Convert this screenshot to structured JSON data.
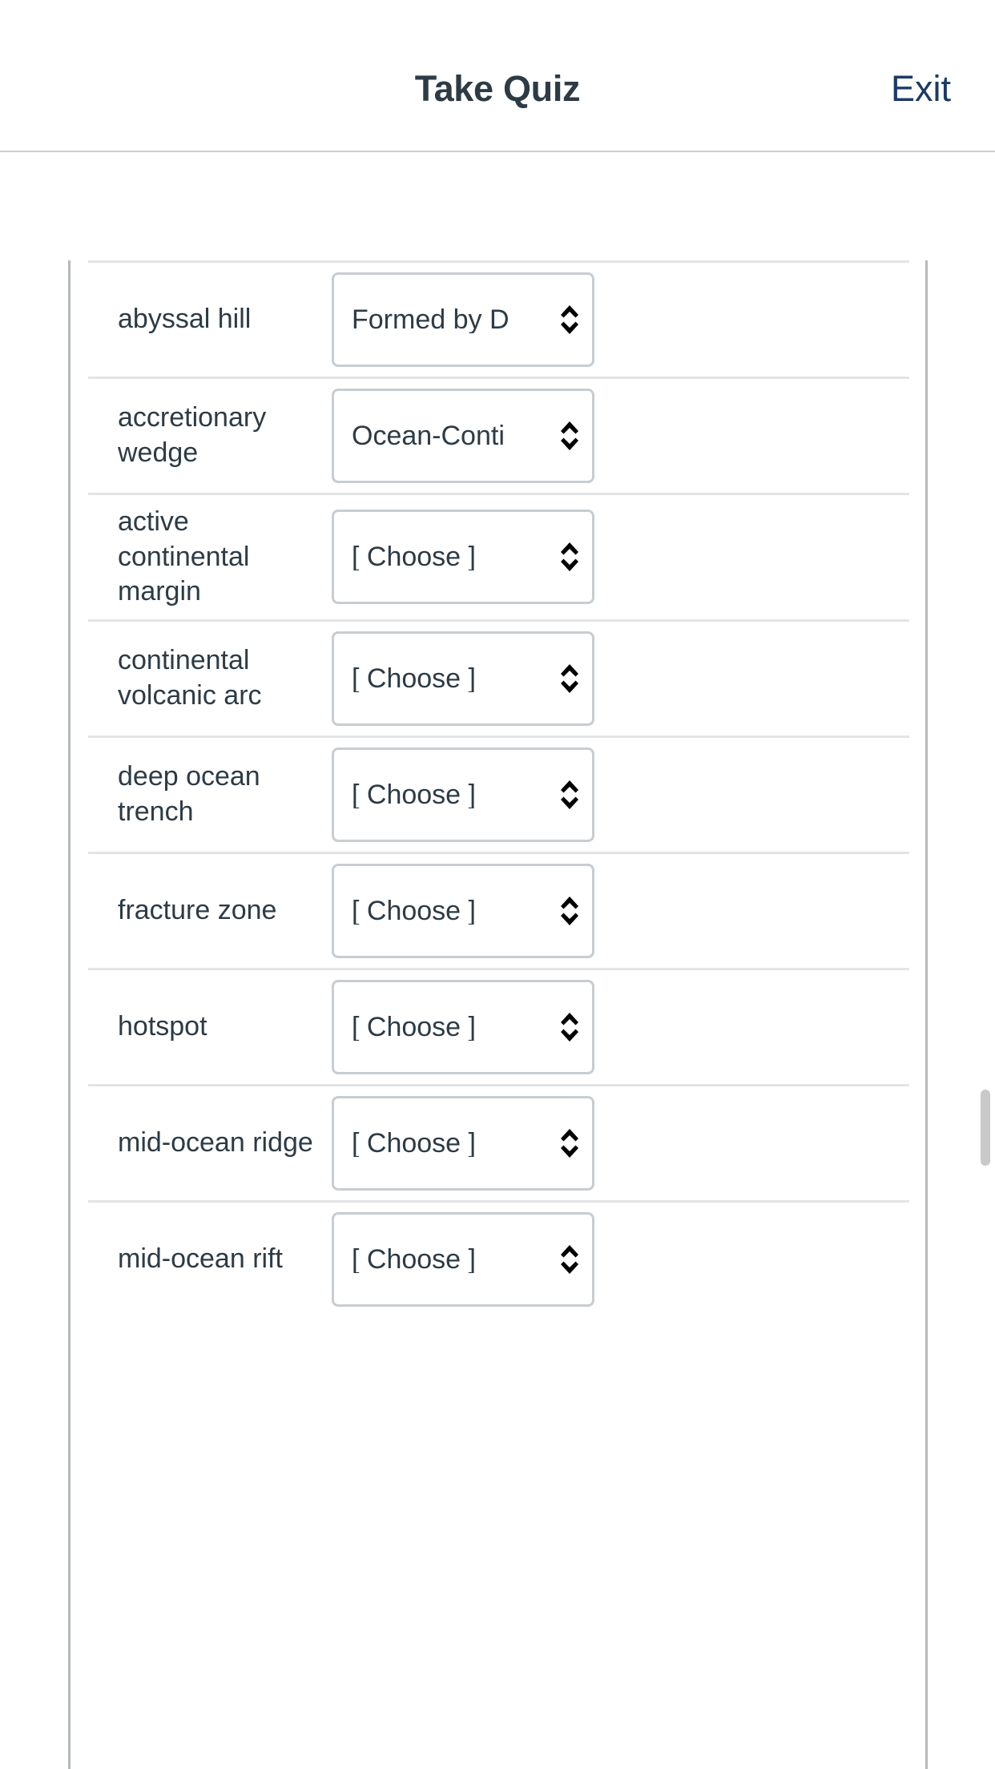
{
  "header": {
    "title": "Take Quiz",
    "exit_label": "Exit"
  },
  "quiz": {
    "rows": [
      {
        "term": "abyssal hill",
        "selected": "Formed by D",
        "icon": "chevron-up-down-icon"
      },
      {
        "term": "accretionary wedge",
        "selected": "Ocean-Conti",
        "icon": "chevron-up-down-icon"
      },
      {
        "term": "active continental margin",
        "selected": "[ Choose ]",
        "icon": "chevron-up-down-icon"
      },
      {
        "term": "continental volcanic arc",
        "selected": "[ Choose ]",
        "icon": "chevron-up-down-icon"
      },
      {
        "term": "deep ocean trench",
        "selected": "[ Choose ]",
        "icon": "chevron-up-down-icon"
      },
      {
        "term": "fracture zone",
        "selected": "[ Choose ]",
        "icon": "chevron-up-down-icon"
      },
      {
        "term": "hotspot",
        "selected": "[ Choose ]",
        "icon": "chevron-up-down-icon"
      },
      {
        "term": "mid-ocean ridge",
        "selected": "[ Choose ]",
        "icon": "chevron-up-down-icon"
      },
      {
        "term": "mid-ocean rift",
        "selected": "[ Choose ]",
        "icon": "chevron-up-down-icon"
      }
    ]
  },
  "scrollbar": {
    "name": "page-vertical-scrollbar"
  },
  "colors": {
    "title_text": "#2d3b45",
    "link": "#1b3a68",
    "border": "#c7cdd1",
    "divider": "#e3e4e5",
    "container_edge": "#b6b9bb",
    "scrollbar_thumb": "#c9c9c9"
  }
}
